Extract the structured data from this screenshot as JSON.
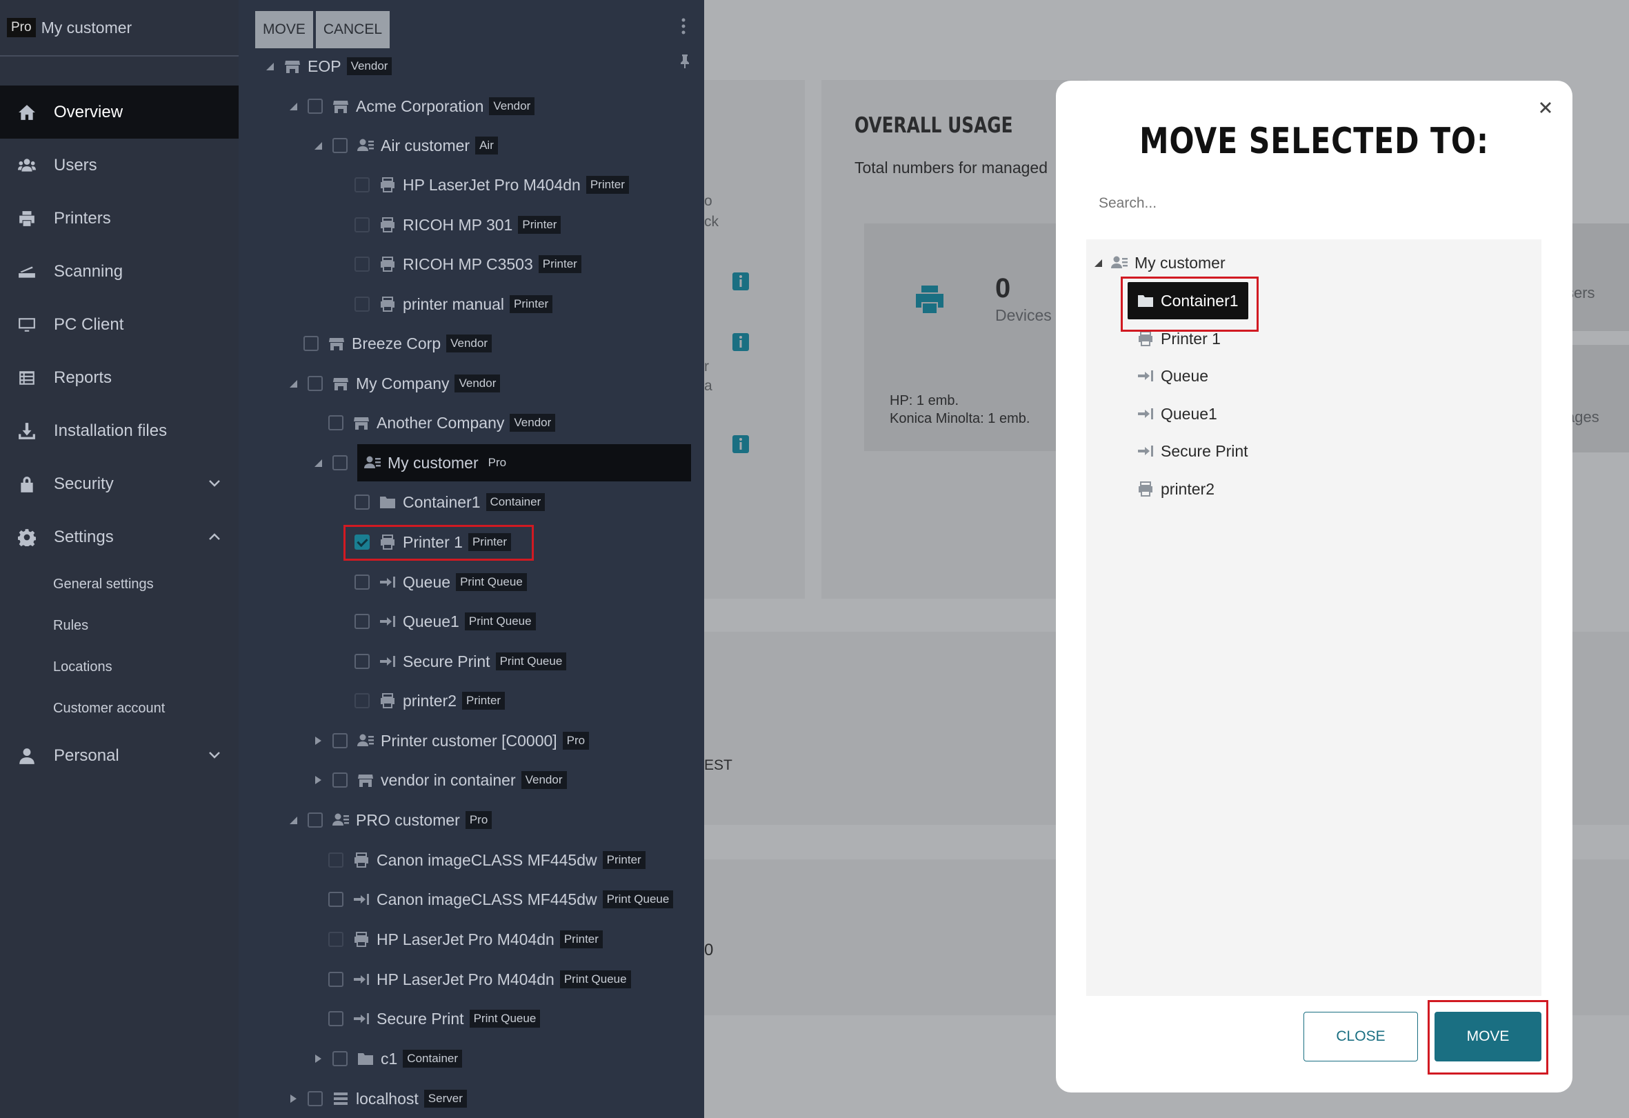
{
  "sidebar": {
    "pro_badge": "Pro",
    "customer_name": "My customer",
    "items": [
      {
        "label": "Overview",
        "icon": "home-icon"
      },
      {
        "label": "Users",
        "icon": "users-icon"
      },
      {
        "label": "Printers",
        "icon": "printer-icon"
      },
      {
        "label": "Scanning",
        "icon": "scanner-icon"
      },
      {
        "label": "PC Client",
        "icon": "monitor-icon"
      },
      {
        "label": "Reports",
        "icon": "reports-icon"
      },
      {
        "label": "Installation files",
        "icon": "download-icon"
      },
      {
        "label": "Security",
        "icon": "lock-icon"
      },
      {
        "label": "Settings",
        "icon": "gear-icon"
      }
    ],
    "settings_sub": [
      "General settings",
      "Rules",
      "Locations",
      "Customer account"
    ],
    "personal": {
      "label": "Personal",
      "icon": "person-icon"
    }
  },
  "tree_panel": {
    "move_label": "MOVE",
    "cancel_label": "CANCEL",
    "rows": [
      {
        "label": "EOP",
        "badge": "Vendor"
      },
      {
        "label": "Acme Corporation",
        "badge": "Vendor"
      },
      {
        "label": "Air customer",
        "badge": "Air"
      },
      {
        "label": "HP LaserJet Pro M404dn",
        "badge": "Printer"
      },
      {
        "label": "RICOH MP 301",
        "badge": "Printer"
      },
      {
        "label": "RICOH MP C3503",
        "badge": "Printer"
      },
      {
        "label": "printer manual",
        "badge": "Printer"
      },
      {
        "label": "Breeze Corp",
        "badge": "Vendor"
      },
      {
        "label": "My Company",
        "badge": "Vendor"
      },
      {
        "label": "Another Company",
        "badge": "Vendor"
      },
      {
        "label": "My customer",
        "badge": "Pro"
      },
      {
        "label": "Container1",
        "badge": "Container"
      },
      {
        "label": "Printer 1",
        "badge": "Printer"
      },
      {
        "label": "Queue",
        "badge": "Print Queue"
      },
      {
        "label": "Queue1",
        "badge": "Print Queue"
      },
      {
        "label": "Secure Print",
        "badge": "Print Queue"
      },
      {
        "label": "printer2",
        "badge": "Printer"
      },
      {
        "label": "Printer customer [C0000]",
        "badge": "Pro"
      },
      {
        "label": "vendor in container",
        "badge": "Vendor"
      },
      {
        "label": "PRO customer",
        "badge": "Pro"
      },
      {
        "label": "Canon imageCLASS MF445dw",
        "badge": "Printer"
      },
      {
        "label": "Canon imageCLASS MF445dw",
        "badge": "Print Queue"
      },
      {
        "label": "HP LaserJet Pro M404dn",
        "badge": "Printer"
      },
      {
        "label": "HP LaserJet Pro M404dn",
        "badge": "Print Queue"
      },
      {
        "label": "Secure Print",
        "badge": "Print Queue"
      },
      {
        "label": "c1",
        "badge": "Container"
      },
      {
        "label": "localhost",
        "badge": "Server"
      }
    ]
  },
  "background": {
    "overall_usage_title": "OVERALL USAGE",
    "overall_usage_sub": "Total numbers for managed",
    "devices_count": "0",
    "devices_label": "Devices",
    "hp_line": "HP: 1 emb.",
    "konica_line": "Konica Minolta: 1 emb.",
    "frag_users": "sers",
    "frag_pages": "ages",
    "frag_o": "o",
    "frag_ck": "ck",
    "frag_r": "r",
    "frag_a": "a",
    "frag_est": "EST",
    "frag_zero": "0"
  },
  "modal": {
    "title": "MOVE SELECTED TO:",
    "search_placeholder": "Search...",
    "tree": [
      {
        "label": "My customer",
        "icon": "customer-icon"
      },
      {
        "label": "Container1",
        "icon": "folder-icon"
      },
      {
        "label": "Printer 1",
        "icon": "printer-icon"
      },
      {
        "label": "Queue",
        "icon": "queue-icon"
      },
      {
        "label": "Queue1",
        "icon": "queue-icon"
      },
      {
        "label": "Secure Print",
        "icon": "queue-icon"
      },
      {
        "label": "printer2",
        "icon": "printer-icon"
      }
    ],
    "close_label": "CLOSE",
    "move_label": "MOVE"
  },
  "colors": {
    "accent": "#1a6f82",
    "highlight": "#d11a22",
    "sidebar": "#2c323f"
  }
}
